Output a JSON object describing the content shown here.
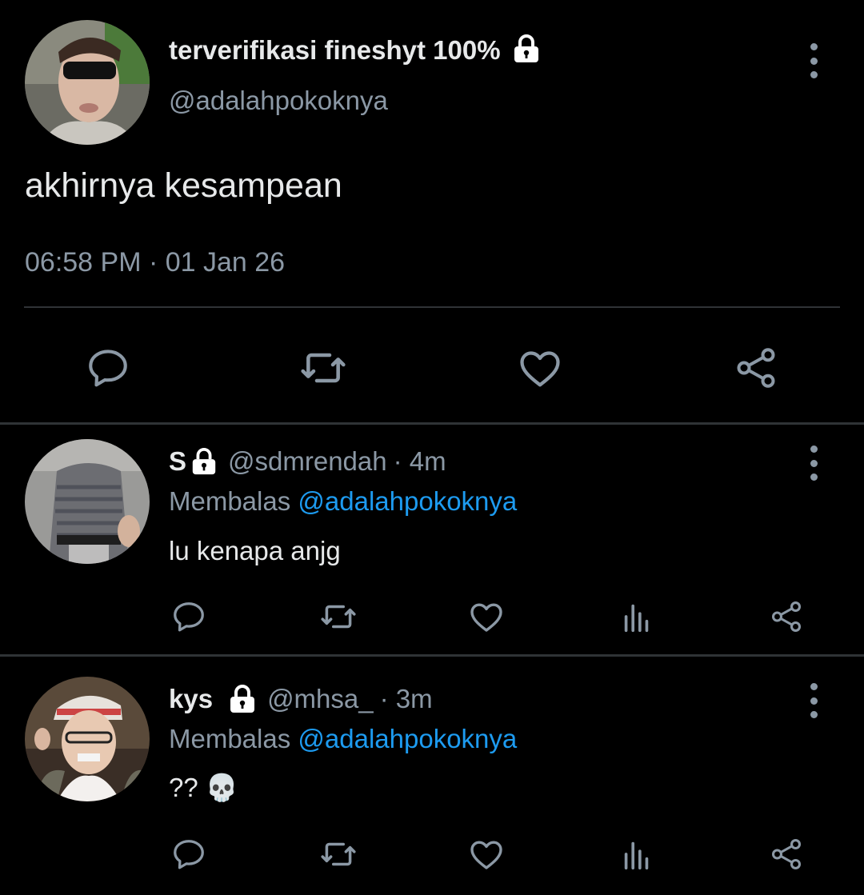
{
  "tweet": {
    "display_name": "terverifikasi fineshyt 100%",
    "handle": "@adalahpokoknya",
    "text": "akhirnya kesampean",
    "timestamp": "06:58 PM · 01 Jan 26"
  },
  "replies": [
    {
      "display_name": "S",
      "handle": "@sdmrendah",
      "time": "· 4m",
      "replying_label": "Membalas",
      "replying_to": "@adalahpokoknya",
      "text": "lu kenapa anjg"
    },
    {
      "display_name": "kys",
      "handle": "@mhsa_",
      "time": "· 3m",
      "replying_label": "Membalas",
      "replying_to": "@adalahpokoknya",
      "text": "?? 💀"
    }
  ],
  "icons": {
    "lock": "lock-icon",
    "reply": "comment-icon",
    "retweet": "retweet-icon",
    "like": "heart-icon",
    "views": "analytics-icon",
    "share": "share-icon",
    "menu": "more-vertical-icon"
  },
  "colors": {
    "background": "#000000",
    "text_primary": "#e7e9ea",
    "text_secondary": "#8b98a5",
    "mention": "#1d9bf0",
    "divider": "#2f3336"
  }
}
